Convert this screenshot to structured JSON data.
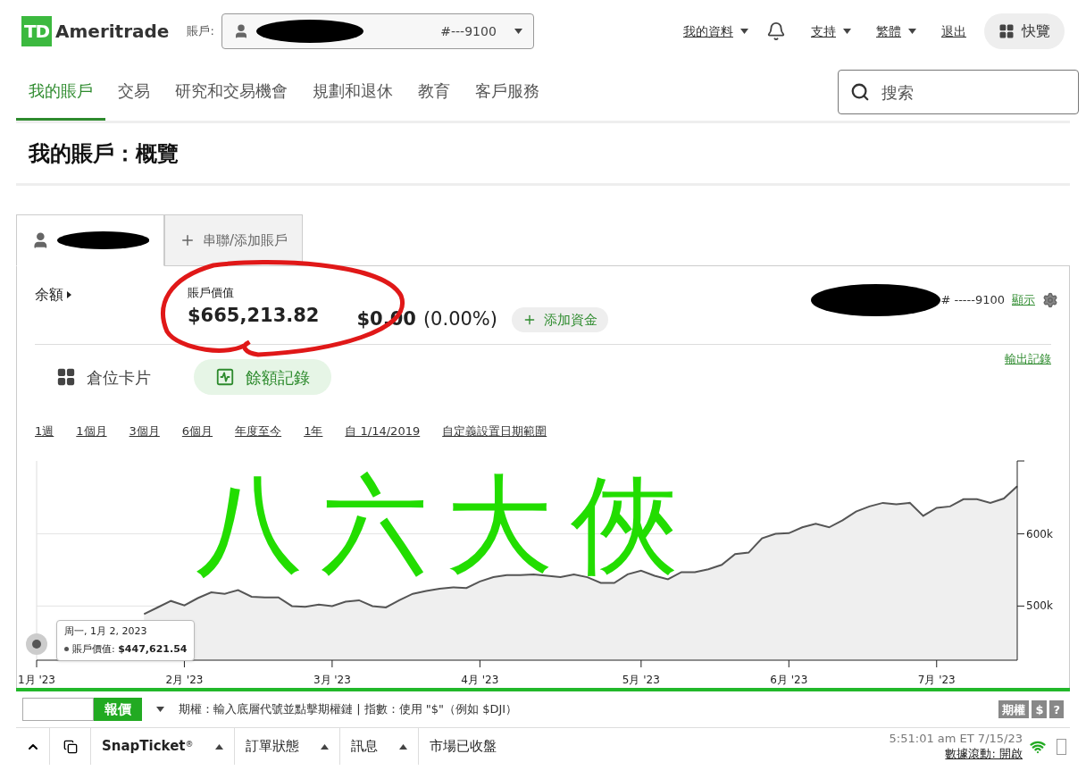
{
  "header": {
    "logo_mark": "TD",
    "logo_text": "Ameritrade",
    "account_label": "賬戶:",
    "account_number": "#---9100",
    "menu": [
      {
        "label": "我的資料",
        "dropdown": true
      },
      {
        "kind": "bell"
      },
      {
        "label": "支持",
        "dropdown": true
      },
      {
        "label": "繁體",
        "dropdown": true
      },
      {
        "label": "退出",
        "dropdown": false
      }
    ],
    "quick_view": "快覽"
  },
  "nav": {
    "tabs": [
      {
        "label": "我的賬戶",
        "selected": true
      },
      {
        "label": "交易",
        "selected": false
      },
      {
        "label": "研究和交易機會",
        "selected": false
      },
      {
        "label": "規劃和退休",
        "selected": false
      },
      {
        "label": "教育",
        "selected": false
      },
      {
        "label": "客戶服務",
        "selected": false
      }
    ],
    "search": {
      "placeholder": "搜索"
    }
  },
  "page_title": "我的賬戶：概覽",
  "account_tabs": [
    {
      "kind": "account",
      "selected": true
    },
    {
      "kind": "add",
      "label": "串聯/添加賬戶",
      "selected": false
    }
  ],
  "summary": {
    "balance_label": "余額",
    "value_label": "賬戶價值",
    "value": "$665,213.82",
    "change": "$0.00",
    "change_pct": "(0.00%)",
    "add_funds": "添加資金",
    "account_number": "# -----9100",
    "show_link": "顯示"
  },
  "views": [
    {
      "kind": "cards",
      "label": "倉位卡片",
      "selected": false
    },
    {
      "kind": "history",
      "label": "餘額記錄",
      "selected": true
    }
  ],
  "export_link": "輸出記錄",
  "ranges": [
    "1週",
    "1個月",
    "3個月",
    "6個月",
    "年度至今",
    "1年",
    "自 1/14/2019",
    "自定義設置日期範圍"
  ],
  "chart_data": {
    "type": "area",
    "ylim": [
      425000,
      701000
    ],
    "categories": [
      "1月 '23",
      null,
      null,
      null,
      null,
      null,
      null,
      null,
      null,
      null,
      null,
      "2月 '23",
      null,
      null,
      null,
      null,
      null,
      null,
      null,
      null,
      null,
      null,
      "3月 '23",
      null,
      null,
      null,
      null,
      null,
      null,
      null,
      null,
      null,
      null,
      "4月 '23",
      null,
      null,
      null,
      null,
      null,
      null,
      null,
      null,
      null,
      null,
      null,
      "5月 '23",
      null,
      null,
      null,
      null,
      null,
      null,
      null,
      null,
      null,
      null,
      "6月 '23",
      null,
      null,
      null,
      null,
      null,
      null,
      null,
      null,
      null,
      null,
      "7月 '23",
      null,
      null,
      null,
      null,
      null,
      null
    ],
    "yticks": [
      {
        "value": 500000,
        "label": "500k"
      },
      {
        "value": 600000,
        "label": "600k"
      }
    ],
    "series": [
      {
        "color": "#555555",
        "values": [
          null,
          null,
          null,
          null,
          null,
          null,
          null,
          null,
          489000,
          498000,
          507000,
          501000,
          511000,
          519000,
          517000,
          522000,
          513000,
          512000,
          512000,
          500000,
          499000,
          502000,
          500000,
          506000,
          508000,
          500000,
          498000,
          508000,
          517000,
          521000,
          524000,
          526000,
          525000,
          534000,
          540000,
          543000,
          543000,
          544000,
          542000,
          540000,
          544000,
          540000,
          532000,
          532000,
          544000,
          549000,
          542000,
          537000,
          547000,
          547000,
          551000,
          557000,
          572000,
          574000,
          594000,
          600000,
          601000,
          609000,
          614000,
          609000,
          619000,
          631000,
          638000,
          643000,
          641000,
          643000,
          625000,
          636000,
          638000,
          648000,
          648000,
          643000,
          649000,
          666000
        ]
      }
    ]
  },
  "tooltip": {
    "date": "周一, 1月 2, 2023",
    "value": "賬戶價值: **$447,621.54**"
  },
  "annotation": {
    "handwriting": "八六大俠"
  },
  "footer": {
    "quote_button": "報價",
    "hint": "期權：輸入底層代號並點擊期權鏈 | 指數：使用 \"$\"（例如 $DJI）",
    "tools": [
      "期權",
      "$",
      "?"
    ],
    "panels": [
      {
        "label": "SnapTicket",
        "sup": "®"
      },
      {
        "label": "訂單狀態"
      },
      {
        "label": "訊息"
      }
    ],
    "market_status": "市場已收盤",
    "time": "5:51:01 am ET 7/15/23",
    "streaming": "數據滾動: 開啟"
  }
}
